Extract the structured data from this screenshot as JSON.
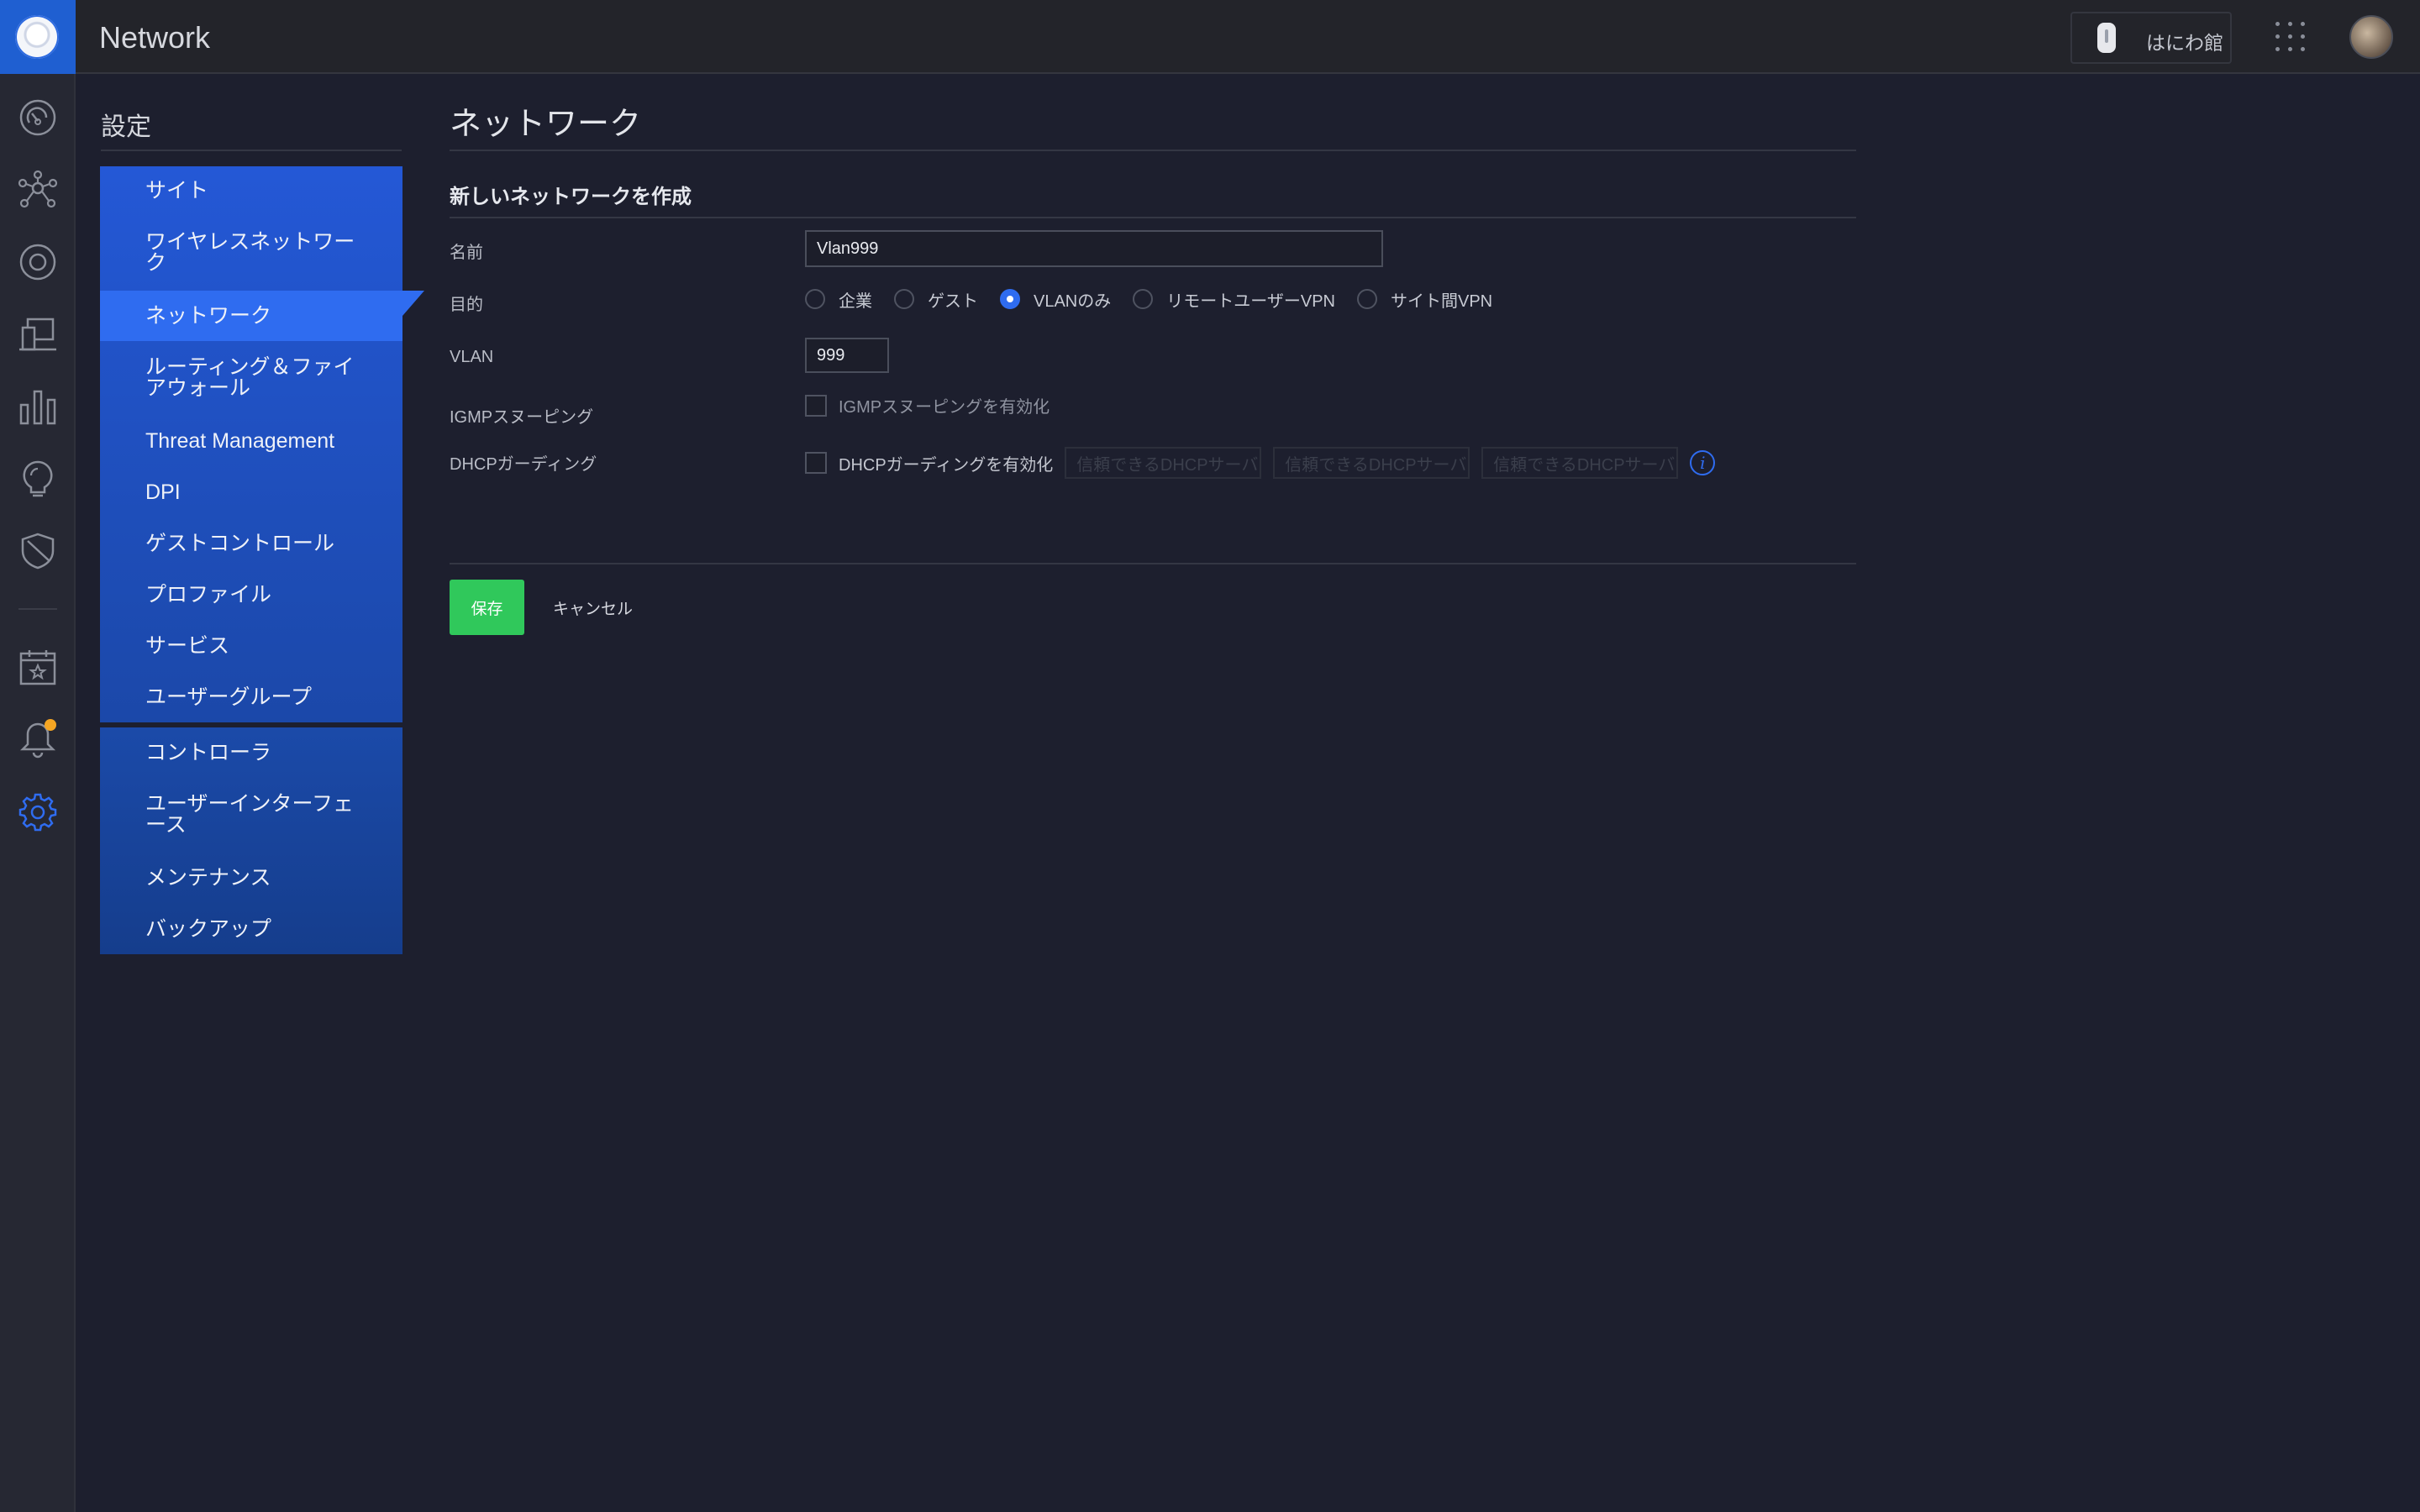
{
  "app": {
    "title": "Network",
    "site_name": "はにわ館"
  },
  "settings": {
    "title": "設定",
    "menu_primary": [
      {
        "label": "サイト",
        "active": false
      },
      {
        "label": "ワイヤレスネットワーク",
        "active": false
      },
      {
        "label": "ネットワーク",
        "active": true
      },
      {
        "label": "ルーティング＆ファイアウォール",
        "active": false
      },
      {
        "label": "Threat Management",
        "active": false
      },
      {
        "label": "DPI",
        "active": false
      },
      {
        "label": "ゲストコントロール",
        "active": false
      },
      {
        "label": "プロファイル",
        "active": false
      },
      {
        "label": "サービス",
        "active": false
      },
      {
        "label": "ユーザーグループ",
        "active": false
      }
    ],
    "menu_secondary": [
      {
        "label": "コントローラ"
      },
      {
        "label": "ユーザーインターフェース"
      },
      {
        "label": "メンテナンス"
      },
      {
        "label": "バックアップ"
      }
    ]
  },
  "page": {
    "title": "ネットワーク",
    "section_title": "新しいネットワークを作成",
    "form": {
      "name_label": "名前",
      "name_value": "Vlan999",
      "purpose_label": "目的",
      "purpose_options": [
        "企業",
        "ゲスト",
        "VLANのみ",
        "リモートユーザーVPN",
        "サイト間VPN"
      ],
      "purpose_selected": "VLANのみ",
      "vlan_label": "VLAN",
      "vlan_value": "999",
      "igmp_label": "IGMPスヌーピング",
      "igmp_checkbox_label": "IGMPスヌーピングを有効化",
      "igmp_checked": false,
      "dhcp_label": "DHCPガーディング",
      "dhcp_checkbox_label": "DHCPガーディングを有効化",
      "dhcp_checked": false,
      "dhcp_trusted_placeholders": [
        "信頼できるDHCPサーバ",
        "信頼できるDHCPサーバ",
        "信頼できるDHCPサーバ"
      ]
    },
    "buttons": {
      "save": "保存",
      "cancel": "キャンセル"
    }
  },
  "colors": {
    "accent": "#2f6cf0",
    "save": "#30c85b",
    "background": "#1d1f2e",
    "notification": "#f5a623"
  },
  "icons": {
    "rail": [
      "dashboard-icon",
      "topology-icon",
      "devices-icon",
      "clients-icon",
      "statistics-icon",
      "insights-icon",
      "security-icon",
      "events-icon",
      "alerts-icon",
      "settings-icon"
    ]
  }
}
